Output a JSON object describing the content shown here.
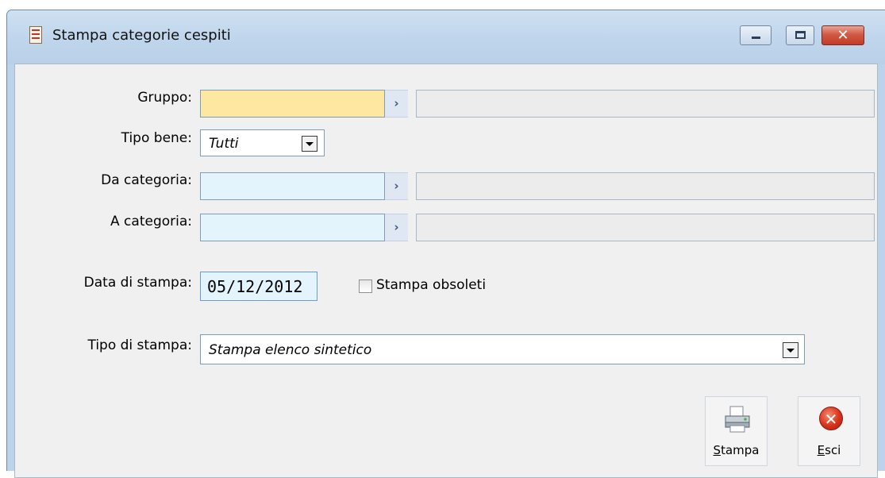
{
  "window": {
    "title": "Stampa categorie cespiti",
    "minimize_icon": "minimize-icon",
    "maximize_icon": "maximize-icon",
    "close_glyph": "✕"
  },
  "form": {
    "gruppo": {
      "label": "Gruppo:",
      "value": "",
      "description": ""
    },
    "tipo_bene": {
      "label": "Tipo bene:",
      "value": "Tutti"
    },
    "da_categoria": {
      "label": "Da categoria:",
      "value": "",
      "description": ""
    },
    "a_categoria": {
      "label": "A categoria:",
      "value": "",
      "description": ""
    },
    "data_stampa": {
      "label": "Data di stampa:",
      "value": "05/12/2012"
    },
    "stampa_obsoleti": {
      "label": "Stampa obsoleti",
      "checked": false
    },
    "tipo_stampa": {
      "label": "Tipo di stampa:",
      "value": "Stampa elenco sintetico"
    },
    "zoom_glyph": "›"
  },
  "buttons": {
    "stampa": "Stampa",
    "esci": "Esci",
    "esci_glyph": "✕"
  },
  "colors": {
    "mandatory_field": "#fde7a1",
    "editable_field": "#e4f4fd",
    "readonly_field": "#ececec",
    "frame": "#bcd3ea"
  }
}
